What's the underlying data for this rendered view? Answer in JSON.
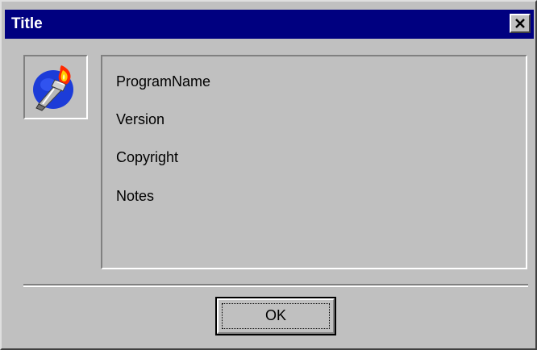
{
  "window": {
    "title": "Title"
  },
  "titlebar": {
    "close_icon": "close-icon",
    "background_color": "#000080"
  },
  "app_icon": {
    "icon": "torch-icon"
  },
  "info": {
    "program_name": "ProgramName",
    "version": "Version",
    "copyright": "Copyright",
    "notes": "Notes"
  },
  "buttons": {
    "ok_label": "OK"
  },
  "colors": {
    "face": "#c0c0c0",
    "highlight": "#ffffff",
    "shadow": "#808080"
  }
}
